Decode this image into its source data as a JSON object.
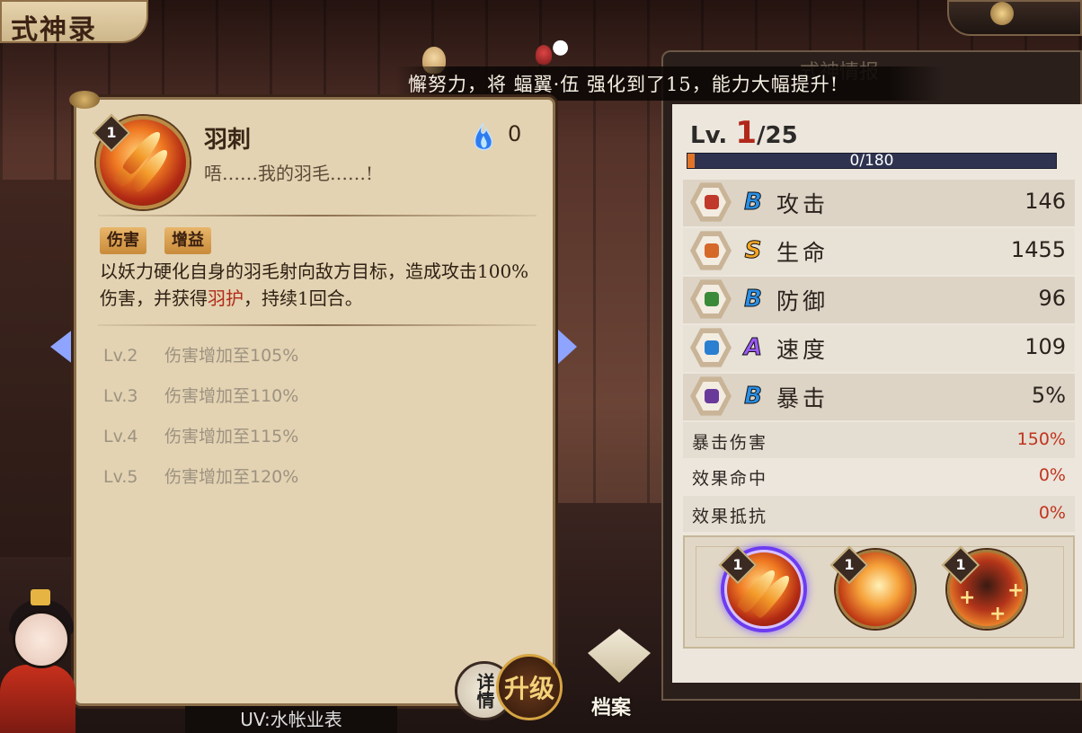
{
  "header": {
    "title": "式神录"
  },
  "banner": {
    "text": "懈努力，将 蝠翼·伍 强化到了15，能力大幅提升!"
  },
  "side_panel": {
    "title": "式神情报"
  },
  "skill_detail": {
    "level_badge": "1",
    "name": "羽刺",
    "quote": "唔……我的羽毛……!",
    "fire_cost": "0",
    "tags": [
      "伤害",
      "增益"
    ],
    "description_before": "以妖力硬化自身的羽毛射向敌方目标，造成攻击100%伤害，并获得",
    "description_highlight": "羽护",
    "description_after": "，持续1回合。",
    "upgrades": [
      {
        "level": "Lv.2",
        "effect": "伤害增加至105%"
      },
      {
        "level": "Lv.3",
        "effect": "伤害增加至110%"
      },
      {
        "level": "Lv.4",
        "effect": "伤害增加至115%"
      },
      {
        "level": "Lv.5",
        "effect": "伤害增加至120%"
      }
    ]
  },
  "buttons": {
    "detail": "详情",
    "upgrade": "升级",
    "archive": "档案"
  },
  "under_tag": "UV:水帐业表",
  "stats": {
    "level_prefix": "Lv. ",
    "level_current": "1",
    "level_max": "/25",
    "exp_text": "0/180",
    "exp_fraction": 0.0,
    "main": [
      {
        "name": "攻击",
        "grade": "B",
        "value": "146",
        "grade_color": "#2a8fe6",
        "icon_color": "#c0392b"
      },
      {
        "name": "生命",
        "grade": "S",
        "value": "1455",
        "grade_color": "#f5a623",
        "icon_color": "#d5692a"
      },
      {
        "name": "防御",
        "grade": "B",
        "value": "96",
        "grade_color": "#2a8fe6",
        "icon_color": "#3a8a3a"
      },
      {
        "name": "速度",
        "grade": "A",
        "value": "109",
        "grade_color": "#9b59f5",
        "icon_color": "#2a7fd0"
      },
      {
        "name": "暴击",
        "grade": "B",
        "value": "5%",
        "grade_color": "#2a8fe6",
        "icon_color": "#6a3a9a"
      }
    ],
    "sub": [
      {
        "name": "暴击伤害",
        "value": "150%"
      },
      {
        "name": "效果命中",
        "value": "0%"
      },
      {
        "name": "效果抵抗",
        "value": "0%"
      }
    ]
  },
  "skill_slots": [
    {
      "level": "1",
      "icon": "feather-dart-skill-icon",
      "selected": true
    },
    {
      "level": "1",
      "icon": "wing-skill-icon",
      "selected": false
    },
    {
      "level": "1",
      "icon": "heal-skill-icon",
      "selected": false
    }
  ]
}
